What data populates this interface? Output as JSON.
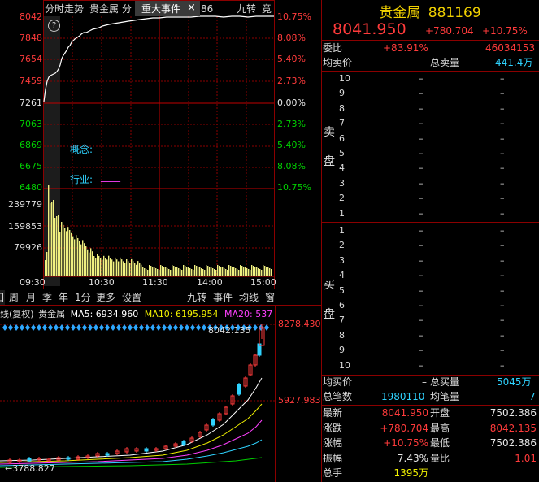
{
  "intraday": {
    "tabs": [
      "分时走势",
      "贵金属",
      "分",
      "重大事件",
      "86",
      "九转",
      "竞"
    ],
    "close_icon": "×",
    "price_labels": [
      "8042",
      "7848",
      "7654",
      "7459",
      "7261",
      "7063",
      "6869",
      "6675",
      "6480"
    ],
    "pct_labels": [
      "10.75%",
      "8.08%",
      "5.40%",
      "2.73%",
      "0.00%",
      "2.73%",
      "5.40%",
      "8.08%",
      "10.75%"
    ],
    "volume_labels": [
      "239779",
      "159853",
      "79926"
    ],
    "time_labels": [
      "09:30",
      "10:30",
      "11:30",
      "14:00",
      "15:00"
    ],
    "concept_label": "概念:",
    "industry_label": "行业:",
    "industry_value": "____",
    "help_icon": "?"
  },
  "kline": {
    "tabs": [
      "周",
      "月",
      "季",
      "年",
      "1分",
      "更多",
      "设置",
      "九转",
      "事件",
      "均线",
      "窗"
    ],
    "tab_day": "日",
    "legend_prefix": "线(复权)",
    "legend_name": "贵金属",
    "ma5": "MA5: 6934.960",
    "ma10": "MA10: 6195.954",
    "ma20": "MA20: 537",
    "high_label": "8278.430",
    "mid_label": "5927.983",
    "peak_label": "8042.135",
    "low_label": "3788.827",
    "arrow_icon": "←"
  },
  "quote": {
    "name": "贵金属",
    "code": "881169",
    "price": "8041.950",
    "change": "+780.704",
    "change_pct": "+10.75%",
    "weibi_label": "委比",
    "weibi_value": "+83.91%",
    "weicha_value": "46034153",
    "avg_sell_label": "均卖价",
    "avg_sell_value": "–",
    "total_sell_label": "总卖量",
    "total_sell_value": "441.4万",
    "sell_side_label_1": "卖",
    "sell_side_label_2": "盘",
    "buy_side_label_1": "买",
    "buy_side_label_2": "盘",
    "sell_levels": [
      "10",
      "9",
      "8",
      "7",
      "6",
      "5",
      "4",
      "3",
      "2",
      "1"
    ],
    "buy_levels": [
      "1",
      "2",
      "3",
      "4",
      "5",
      "6",
      "7",
      "8",
      "9",
      "10"
    ],
    "dash": "–",
    "avg_buy_label": "均买价",
    "avg_buy_value": "–",
    "total_buy_label": "总买量",
    "total_buy_value": "5045万",
    "total_trades_label": "总笔数",
    "total_trades_value": "1980110",
    "avg_qty_label": "均笔量",
    "avg_qty_value": "7",
    "stats": [
      {
        "l1": "最新",
        "v1": "8041.950",
        "c1": "red",
        "l2": "开盘",
        "v2": "7502.386",
        "c2": "white"
      },
      {
        "l1": "涨跌",
        "v1": "+780.704",
        "c1": "red",
        "l2": "最高",
        "v2": "8042.135",
        "c2": "red"
      },
      {
        "l1": "涨幅",
        "v1": "+10.75%",
        "c1": "red",
        "l2": "最低",
        "v2": "7502.386",
        "c2": "white"
      },
      {
        "l1": "振幅",
        "v1": "7.43%",
        "c1": "white",
        "l2": "量比",
        "v2": "1.01",
        "c2": "red"
      },
      {
        "l1": "总手",
        "v1": "1395万",
        "c1": "yellow",
        "l2": "",
        "v2": "",
        "c2": "white"
      }
    ]
  },
  "colors": {
    "up": "#ff3b3b",
    "down": "#00d000",
    "grid": "#8b0000",
    "line": "#ffffff",
    "volume": "#f0f080",
    "accent_cyan": "#2fd3ff"
  }
}
